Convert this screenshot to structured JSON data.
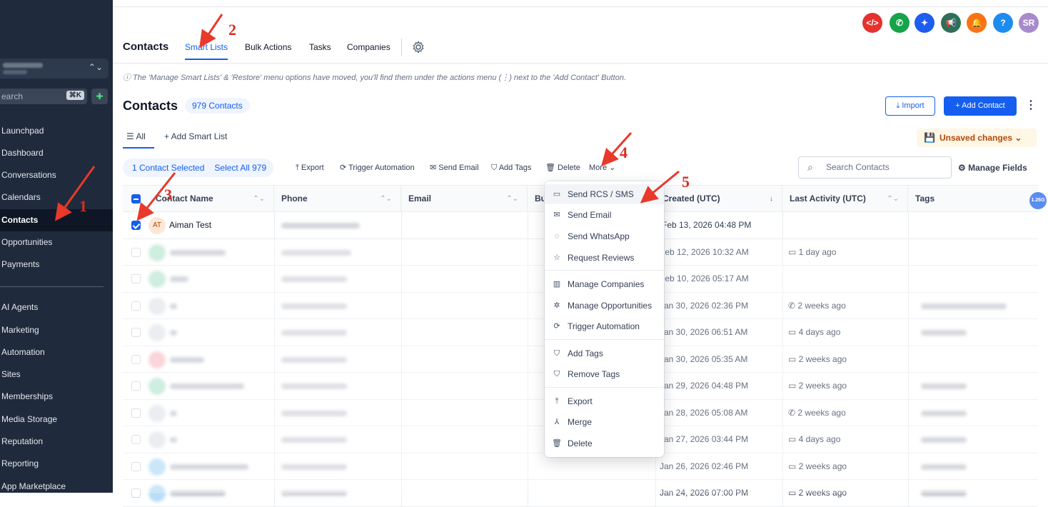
{
  "sidebar": {
    "search_placeholder": "earch",
    "search_shortcut": "⌘K",
    "items": [
      {
        "label": "Launchpad"
      },
      {
        "label": "Dashboard"
      },
      {
        "label": "Conversations"
      },
      {
        "label": "Calendars"
      },
      {
        "label": "Contacts"
      },
      {
        "label": "Opportunities"
      },
      {
        "label": "Payments"
      },
      {
        "label": "AI Agents"
      },
      {
        "label": "Marketing"
      },
      {
        "label": "Automation"
      },
      {
        "label": "Sites"
      },
      {
        "label": "Memberships"
      },
      {
        "label": "Media Storage"
      },
      {
        "label": "Reputation"
      },
      {
        "label": "Reporting"
      },
      {
        "label": "App Marketplace"
      }
    ]
  },
  "topbar": {
    "user_initials": "SR",
    "help": "?",
    "colors": {
      "red": "#e5322d",
      "green": "#17a34a",
      "blue": "#1d5df0",
      "teal": "#2f6f5a",
      "orange": "#f97316",
      "help": "#1d8cf0",
      "avatar": "#a78bca"
    }
  },
  "tabs": [
    {
      "label": "Contacts"
    },
    {
      "label": "Smart Lists"
    },
    {
      "label": "Bulk Actions"
    },
    {
      "label": "Tasks"
    },
    {
      "label": "Companies"
    }
  ],
  "notice": "ⓘ The 'Manage Smart Lists' & 'Restore' menu options have moved, you'll find them under the actions menu (⋮) next to the 'Add Contact' Button.",
  "page": {
    "title": "Contacts",
    "count_badge": "979 Contacts",
    "import_label": "Import",
    "add_contact_label": "+ Add Contact"
  },
  "subtabs": {
    "all": "All",
    "add_smart_list": "+ Add Smart List"
  },
  "unsaved": "Unsaved changes",
  "actions": {
    "selected": "1 Contact Selected",
    "select_all": "Select All 979",
    "export": "Export",
    "trigger_automation": "Trigger Automation",
    "send_email": "Send Email",
    "add_tags": "Add Tags",
    "delete": "Delete",
    "more": "More",
    "search_placeholder": "Search Contacts",
    "manage_fields": "Manage Fields"
  },
  "table": {
    "columns": [
      "Contact Name",
      "Phone",
      "Email",
      "Bu",
      "Created (UTC)",
      "Last Activity (UTC)",
      "Tags"
    ],
    "rows": [
      {
        "initials": "AT",
        "name": "Aiman Test",
        "created": "Feb 13, 2026 04:48 PM",
        "activity": ""
      },
      {
        "initials": "",
        "name": "",
        "created": "Feb 12, 2026 10:32 AM",
        "activity": "1 day ago"
      },
      {
        "initials": "",
        "name": "",
        "created": "Feb 10, 2026 05:17 AM",
        "activity": ""
      },
      {
        "initials": "",
        "name": "",
        "created": "Jan 30, 2026 02:36 PM",
        "activity": "2 weeks ago"
      },
      {
        "initials": "",
        "name": "",
        "created": "Jan 30, 2026 06:51 AM",
        "activity": "4 days ago"
      },
      {
        "initials": "",
        "name": "",
        "created": "Jan 30, 2026 05:35 AM",
        "activity": "2 weeks ago"
      },
      {
        "initials": "",
        "name": "",
        "created": "Jan 29, 2026 04:48 PM",
        "activity": "2 weeks ago"
      },
      {
        "initials": "",
        "name": "",
        "created": "Jan 28, 2026 05:08 AM",
        "activity": "2 weeks ago"
      },
      {
        "initials": "",
        "name": "",
        "created": "Jan 27, 2026 03:44 PM",
        "activity": "4 days ago"
      },
      {
        "initials": "",
        "name": "",
        "created": "Jan 26, 2026 02:46 PM",
        "activity": "2 weeks ago"
      },
      {
        "initials": "",
        "name": "",
        "created": "Jan 24, 2026 07:00 PM",
        "activity": "2 weeks ago"
      }
    ]
  },
  "more_menu": [
    {
      "label": "Send RCS / SMS",
      "icon": "chat-bubble-icon"
    },
    {
      "label": "Send Email",
      "icon": "mail-icon"
    },
    {
      "label": "Send WhatsApp",
      "icon": "whatsapp-icon"
    },
    {
      "label": "Request Reviews",
      "icon": "star-icon"
    },
    {
      "label": "Manage Companies",
      "icon": "building-icon"
    },
    {
      "label": "Manage Opportunities",
      "icon": "opportunities-icon"
    },
    {
      "label": "Trigger Automation",
      "icon": "automation-icon"
    },
    {
      "label": "Add Tags",
      "icon": "tag-icon"
    },
    {
      "label": "Remove Tags",
      "icon": "tag-remove-icon"
    },
    {
      "label": "Export",
      "icon": "export-icon"
    },
    {
      "label": "Merge",
      "icon": "merge-icon"
    },
    {
      "label": "Delete",
      "icon": "trash-icon"
    }
  ],
  "annotations": [
    "1",
    "2",
    "3",
    "4",
    "5"
  ],
  "floating_badge": "1.26G",
  "accent": "#155eef"
}
